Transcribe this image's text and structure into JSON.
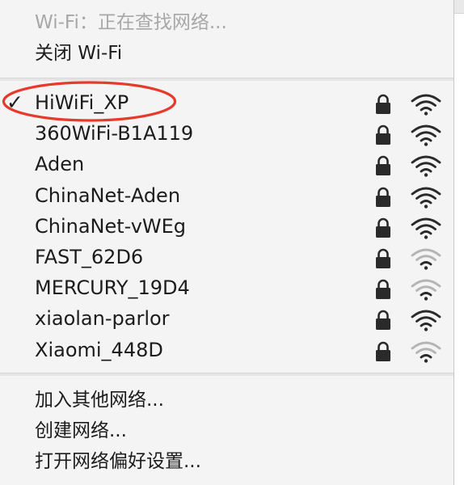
{
  "menu": {
    "status": "Wi-Fi：正在查找网络...",
    "toggle": "关闭 Wi-Fi",
    "networks": [
      {
        "name": "HiWiFi_XP",
        "connected": true,
        "locked": true,
        "signal": "full"
      },
      {
        "name": "360WiFi-B1A119",
        "connected": false,
        "locked": true,
        "signal": "full"
      },
      {
        "name": "Aden",
        "connected": false,
        "locked": true,
        "signal": "full"
      },
      {
        "name": "ChinaNet-Aden",
        "connected": false,
        "locked": true,
        "signal": "full"
      },
      {
        "name": "ChinaNet-vWEg",
        "connected": false,
        "locked": true,
        "signal": "full"
      },
      {
        "name": "FAST_62D6",
        "connected": false,
        "locked": true,
        "signal": "weak"
      },
      {
        "name": "MERCURY_19D4",
        "connected": false,
        "locked": true,
        "signal": "weak"
      },
      {
        "name": "xiaolan-parlor",
        "connected": false,
        "locked": true,
        "signal": "full"
      },
      {
        "name": "Xiaomi_448D",
        "connected": false,
        "locked": true,
        "signal": "weak"
      }
    ],
    "checkmark": "✓",
    "actions": {
      "join_other": "加入其他网络...",
      "create": "创建网络...",
      "open_prefs": "打开网络偏好设置..."
    }
  },
  "icons": {
    "lock": "lock-icon",
    "wifi": "wifi-signal-icon"
  },
  "colors": {
    "menu_bg": "#f4f4f4",
    "text": "#1c1c1c",
    "disabled_text": "#a7a7a7",
    "icon_dark": "#2a2a2a",
    "icon_faded": "#b4b4b4",
    "annotation": "#e53a2c"
  }
}
